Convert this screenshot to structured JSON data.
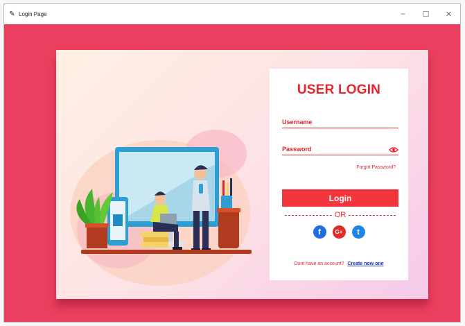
{
  "window": {
    "title": "Login Page",
    "controls": {
      "minimize": "–",
      "maximize": "☐",
      "close": "✕"
    }
  },
  "colors": {
    "background": "#ec3e5e",
    "accent": "#e8242e",
    "button": "#f3363c",
    "link": "#1b34c2"
  },
  "login": {
    "title": "USER LOGIN",
    "username_label": "Username",
    "password_label": "Password",
    "forgot": "Forgot Password?",
    "button": "Login",
    "or": "OR",
    "socials": {
      "facebook": "f",
      "google": "G+",
      "twitter": "t"
    },
    "no_account": "Dont have an account?",
    "create": "Create now one"
  },
  "icons": [
    "pen-icon",
    "eye-icon",
    "facebook-icon",
    "google-plus-icon",
    "twitter-icon"
  ]
}
